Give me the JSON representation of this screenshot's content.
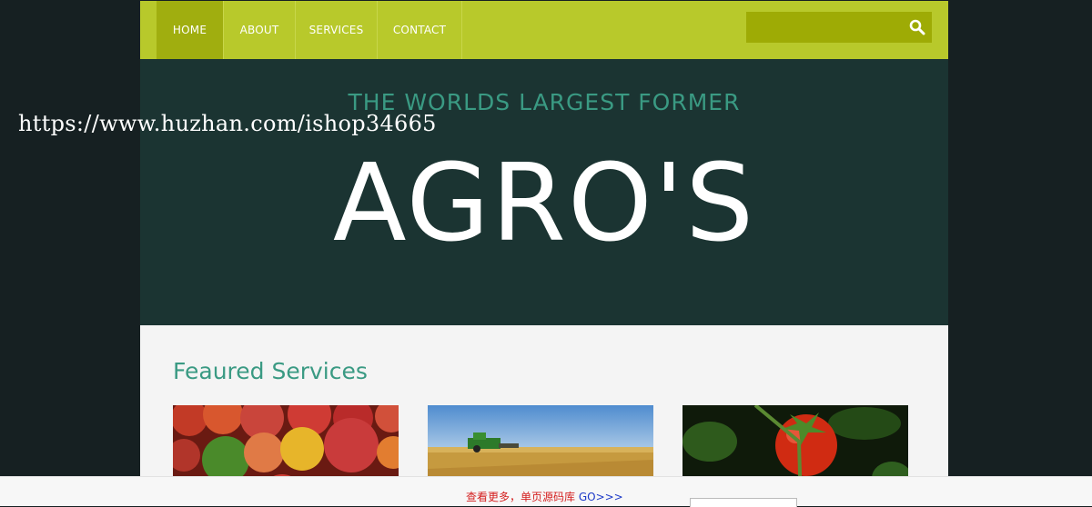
{
  "nav": {
    "items": [
      {
        "label": "HOME",
        "active": true
      },
      {
        "label": "ABOUT",
        "active": false
      },
      {
        "label": "SERVICES",
        "active": false
      },
      {
        "label": "CONTACT",
        "active": false
      }
    ],
    "search": {
      "value": "",
      "icon": "search-icon"
    }
  },
  "hero": {
    "tagline": "THE WORLDS LARGEST FORMER",
    "title": "AGRO'S"
  },
  "services": {
    "title": "Feaured Services",
    "images": [
      "vegetables-image",
      "wheat-harvest-image",
      "tomatoes-image"
    ]
  },
  "watermark": "https://www.huzhan.com/ishop34665",
  "bottom_bar": {
    "text": "查看更多，单页源码库 ",
    "link": "GO>>>"
  },
  "colors": {
    "nav_bg": "#b8c92b",
    "nav_active": "#a0ae0f",
    "hero_bg": "#1b3432",
    "accent": "#3a9a83",
    "outer_bg": "#162022"
  }
}
